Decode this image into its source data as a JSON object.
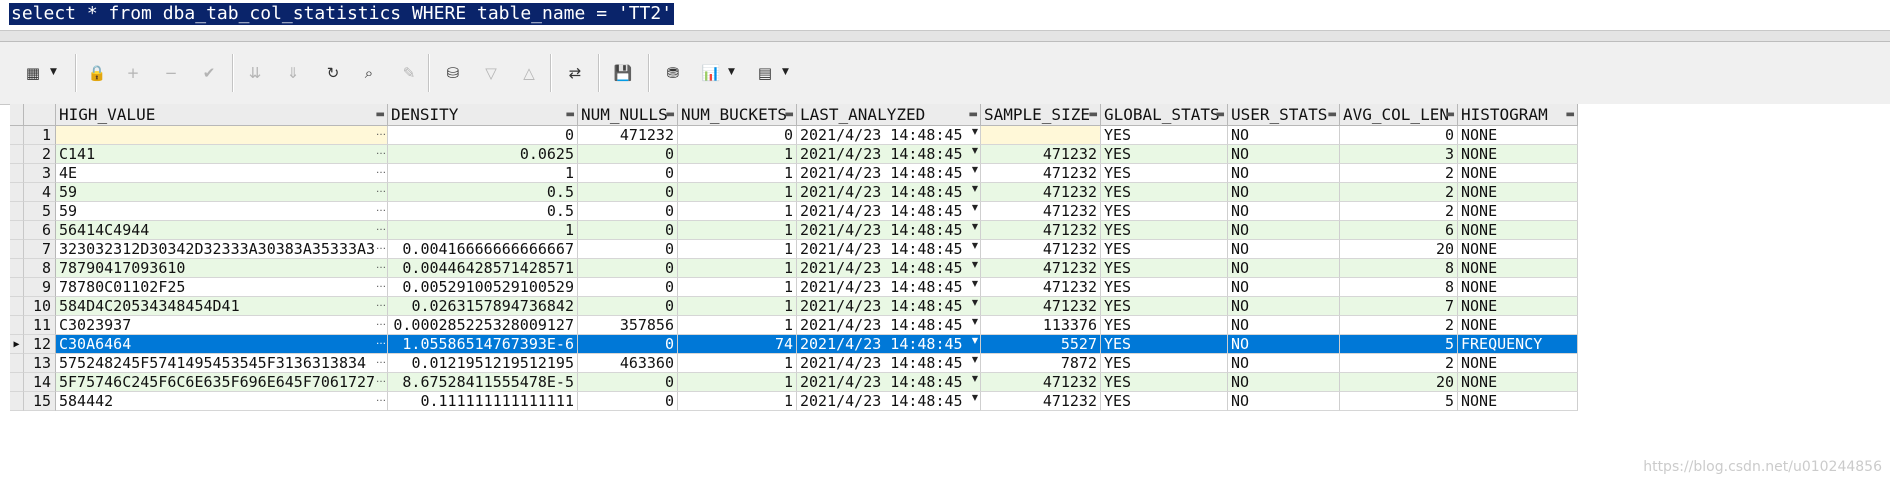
{
  "sql": "select * from dba_tab_col_statistics WHERE table_name = 'TT2'",
  "toolbar": [
    {
      "name": "grid-view-icon",
      "glyph": "▦",
      "enabled": true,
      "dropdown": true
    },
    {
      "name": "lock-icon",
      "glyph": "🔒",
      "enabled": true
    },
    {
      "name": "add-record-icon",
      "glyph": "+",
      "enabled": false
    },
    {
      "name": "delete-record-icon",
      "glyph": "−",
      "enabled": false
    },
    {
      "name": "post-edit-icon",
      "glyph": "✔",
      "enabled": false
    },
    {
      "name": "fetch-next-icon",
      "glyph": "⇊",
      "enabled": false
    },
    {
      "name": "fetch-all-icon",
      "glyph": "⇓",
      "enabled": false
    },
    {
      "name": "refresh-icon",
      "glyph": "↻",
      "enabled": true
    },
    {
      "name": "find-icon",
      "glyph": "⌕",
      "enabled": true
    },
    {
      "name": "clear-icon",
      "glyph": "✎",
      "enabled": false
    },
    {
      "name": "query-by-example-icon",
      "glyph": "⛁",
      "enabled": true
    },
    {
      "name": "next-record-icon",
      "glyph": "▽",
      "enabled": false
    },
    {
      "name": "previous-record-icon",
      "glyph": "△",
      "enabled": false
    },
    {
      "name": "pivot-icon",
      "glyph": "⇄",
      "enabled": true
    },
    {
      "name": "save-icon",
      "glyph": "💾",
      "enabled": true
    },
    {
      "name": "export-icon",
      "glyph": "⛃",
      "enabled": true
    },
    {
      "name": "chart-icon",
      "glyph": "📊",
      "enabled": true,
      "dropdown": true
    },
    {
      "name": "report-icon",
      "glyph": "▤",
      "enabled": true,
      "dropdown": true
    }
  ],
  "columns": [
    "HIGH_VALUE",
    "DENSITY",
    "NUM_NULLS",
    "NUM_BUCKETS",
    "LAST_ANALYZED",
    "SAMPLE_SIZE",
    "GLOBAL_STATS",
    "USER_STATS",
    "AVG_COL_LEN",
    "HISTOGRAM"
  ],
  "rows": [
    [
      "1",
      "",
      "0",
      "471232",
      "0",
      "2021/4/23 14:48:45",
      "",
      "YES",
      "NO",
      "0",
      "NONE"
    ],
    [
      "2",
      "C141",
      "0.0625",
      "0",
      "1",
      "2021/4/23 14:48:45",
      "471232",
      "YES",
      "NO",
      "3",
      "NONE"
    ],
    [
      "3",
      "4E",
      "1",
      "0",
      "1",
      "2021/4/23 14:48:45",
      "471232",
      "YES",
      "NO",
      "2",
      "NONE"
    ],
    [
      "4",
      "59",
      "0.5",
      "0",
      "1",
      "2021/4/23 14:48:45",
      "471232",
      "YES",
      "NO",
      "2",
      "NONE"
    ],
    [
      "5",
      "59",
      "0.5",
      "0",
      "1",
      "2021/4/23 14:48:45",
      "471232",
      "YES",
      "NO",
      "2",
      "NONE"
    ],
    [
      "6",
      "56414C4944",
      "1",
      "0",
      "1",
      "2021/4/23 14:48:45",
      "471232",
      "YES",
      "NO",
      "6",
      "NONE"
    ],
    [
      "7",
      "323032312D30342D32333A30383A35333A3",
      "0.00416666666666667",
      "0",
      "1",
      "2021/4/23 14:48:45",
      "471232",
      "YES",
      "NO",
      "20",
      "NONE"
    ],
    [
      "8",
      "78790417093610",
      "0.00446428571428571",
      "0",
      "1",
      "2021/4/23 14:48:45",
      "471232",
      "YES",
      "NO",
      "8",
      "NONE"
    ],
    [
      "9",
      "78780C01102F25",
      "0.00529100529100529",
      "0",
      "1",
      "2021/4/23 14:48:45",
      "471232",
      "YES",
      "NO",
      "8",
      "NONE"
    ],
    [
      "10",
      "584D4C20534348454D41",
      "0.0263157894736842",
      "0",
      "1",
      "2021/4/23 14:48:45",
      "471232",
      "YES",
      "NO",
      "7",
      "NONE"
    ],
    [
      "11",
      "C3023937",
      "0.000285225328009127",
      "357856",
      "1",
      "2021/4/23 14:48:45",
      "113376",
      "YES",
      "NO",
      "2",
      "NONE"
    ],
    [
      "12",
      "C30A6464",
      "1.05586514767393E-6",
      "0",
      "74",
      "2021/4/23 14:48:45",
      "5527",
      "YES",
      "NO",
      "5",
      "FREQUENCY"
    ],
    [
      "13",
      "575248245F5741495453545F3136313834",
      "0.0121951219512195",
      "463360",
      "1",
      "2021/4/23 14:48:45",
      "7872",
      "YES",
      "NO",
      "2",
      "NONE"
    ],
    [
      "14",
      "5F75746C245F6C6E635F696E645F7061727",
      "8.67528411555478E-5",
      "0",
      "1",
      "2021/4/23 14:48:45",
      "471232",
      "YES",
      "NO",
      "20",
      "NONE"
    ],
    [
      "15",
      "584442",
      "0.111111111111111",
      "0",
      "1",
      "2021/4/23 14:48:45",
      "471232",
      "YES",
      "NO",
      "5",
      "NONE"
    ]
  ],
  "selected_row": 12,
  "watermark": "https://blog.csdn.net/u010244856"
}
